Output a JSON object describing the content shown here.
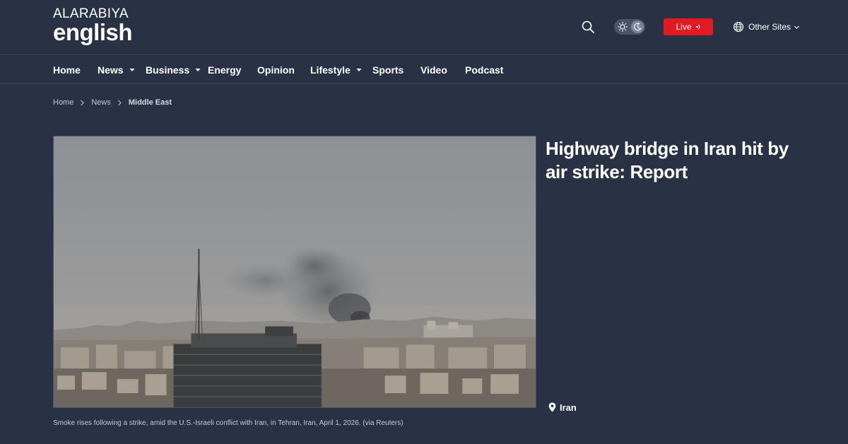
{
  "header": {
    "logo_top": "ALARABIYA",
    "logo_bottom": "english",
    "search_icon": "search-icon",
    "theme_icons": [
      "sun-icon",
      "moon-icon"
    ],
    "live_label": "Live",
    "other_sites_label": "Other Sites"
  },
  "nav": {
    "items": [
      {
        "label": "Home",
        "has_dropdown": false
      },
      {
        "label": "News",
        "has_dropdown": true
      },
      {
        "label": "Business",
        "has_dropdown": true
      },
      {
        "label": "Energy",
        "has_dropdown": false
      },
      {
        "label": "Opinion",
        "has_dropdown": false
      },
      {
        "label": "Lifestyle",
        "has_dropdown": true
      },
      {
        "label": "Sports",
        "has_dropdown": false
      },
      {
        "label": "Video",
        "has_dropdown": false
      },
      {
        "label": "Podcast",
        "has_dropdown": false
      }
    ]
  },
  "breadcrumb": {
    "items": [
      "Home",
      "News",
      "Middle East"
    ]
  },
  "article": {
    "headline": "Highway bridge in Iran hit by air strike: Report",
    "caption": "Smoke rises following a strike, amid the U.S.-Israeli conflict with Iran, in Tehran, Iran, April 1, 2026. (via Reuters)",
    "tag": "Iran"
  },
  "colors": {
    "background": "#293145",
    "live_red": "#e21b23",
    "text": "#ffffff",
    "muted_text": "#c4c9d4"
  }
}
